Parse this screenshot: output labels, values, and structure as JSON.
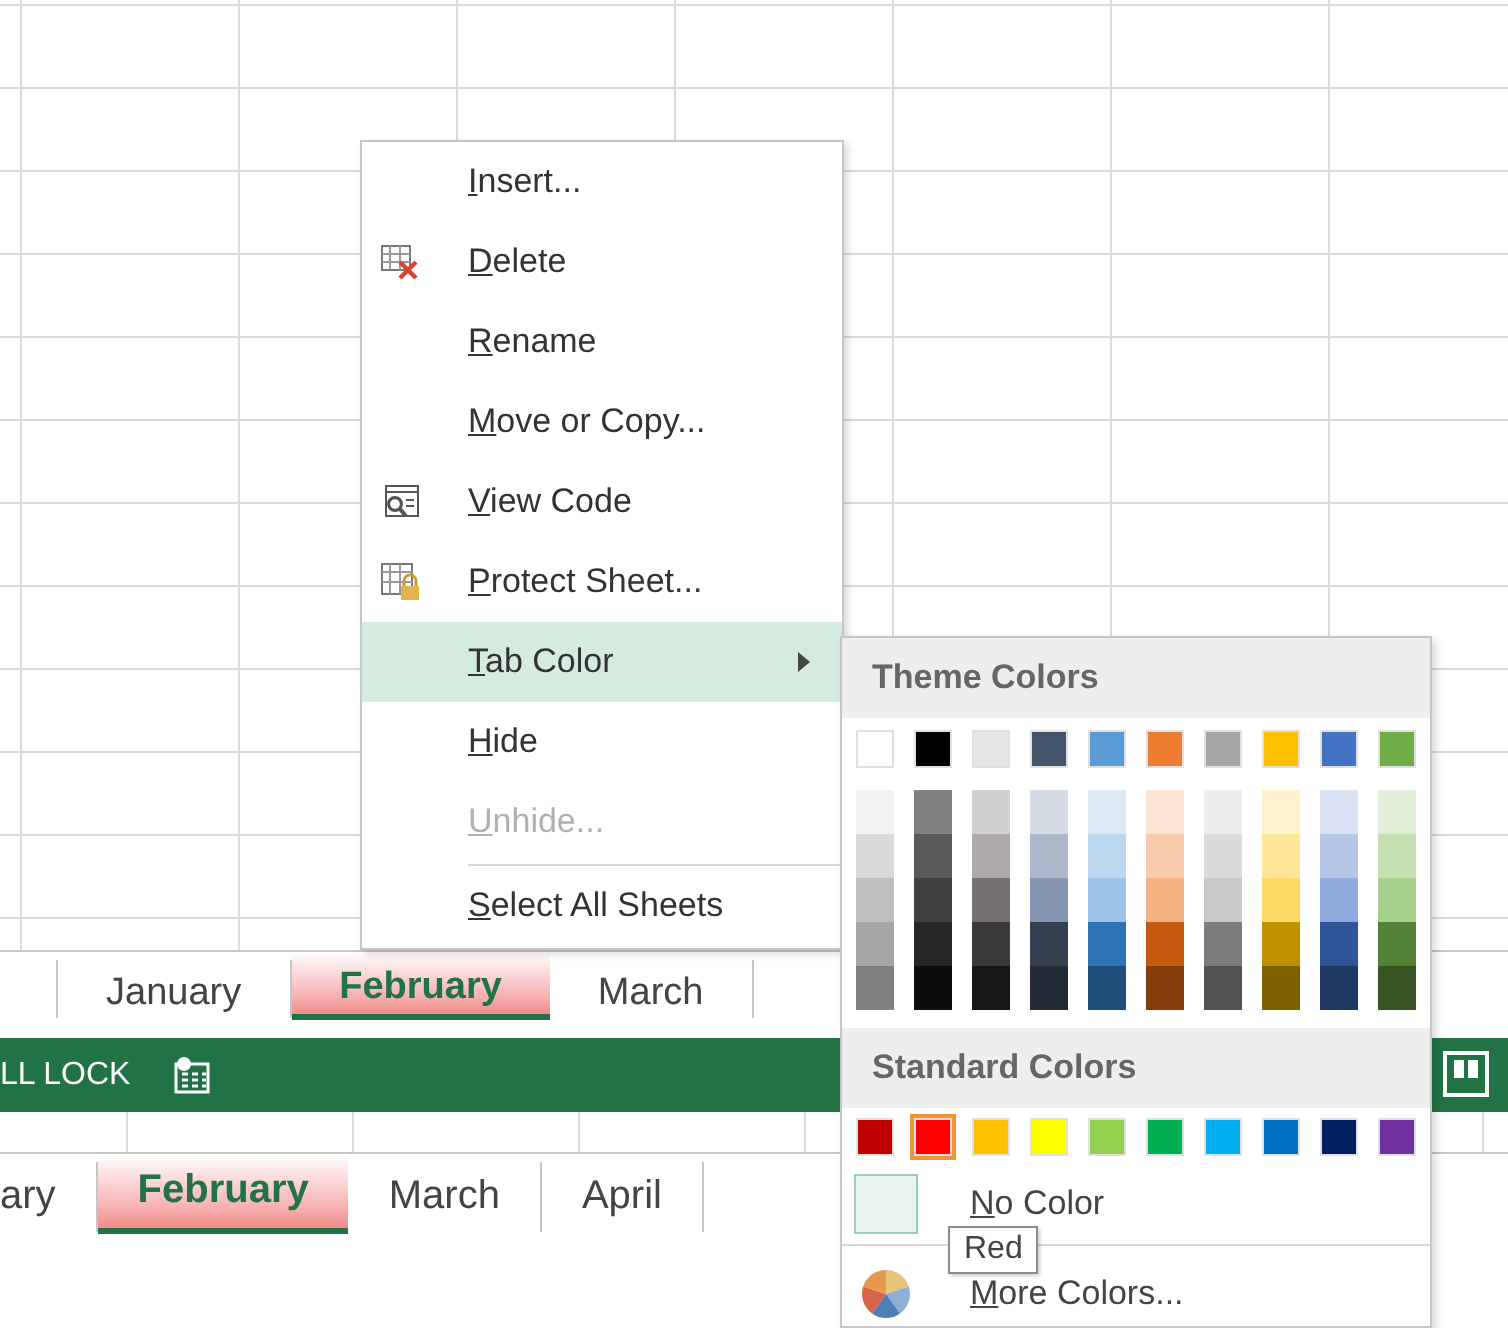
{
  "sheet_tabs_upper": [
    {
      "label": "January",
      "selected": false
    },
    {
      "label": "February",
      "selected": true
    },
    {
      "label": "March",
      "selected": false
    }
  ],
  "status_bar": {
    "text": "LL LOCK"
  },
  "sheet_tabs_lower": [
    {
      "label": "ary",
      "selected": false
    },
    {
      "label": "February",
      "selected": true
    },
    {
      "label": "March",
      "selected": false
    },
    {
      "label": "April",
      "selected": false
    }
  ],
  "context_menu": {
    "items": [
      {
        "label": "Insert...",
        "kind": "plain",
        "disabled": false,
        "selected": false
      },
      {
        "label": "Delete",
        "kind": "delete",
        "disabled": false,
        "selected": false
      },
      {
        "label": "Rename",
        "kind": "plain",
        "disabled": false,
        "selected": false
      },
      {
        "label": "Move or Copy...",
        "kind": "plain",
        "disabled": false,
        "selected": false
      },
      {
        "label": "View Code",
        "kind": "code",
        "disabled": false,
        "selected": false
      },
      {
        "label": "Protect Sheet...",
        "kind": "protect",
        "disabled": false,
        "selected": false
      },
      {
        "label": "Tab Color",
        "kind": "plain",
        "disabled": false,
        "selected": true,
        "submenu": true
      },
      {
        "label": "Hide",
        "kind": "plain",
        "disabled": false,
        "selected": false
      },
      {
        "label": "Unhide...",
        "kind": "plain",
        "disabled": true,
        "selected": false
      },
      {
        "label": "Select All Sheets",
        "kind": "plain",
        "disabled": false,
        "selected": false,
        "separator_before": true
      }
    ]
  },
  "tab_color_submenu": {
    "theme_header": "Theme Colors",
    "theme_colors": [
      {
        "color": "#ffffff",
        "shades": [
          {
            "color": "#f2f2f2"
          },
          {
            "color": "#d9d9d9"
          },
          {
            "color": "#bfbfbf"
          },
          {
            "color": "#a6a6a6"
          },
          {
            "color": "#808080"
          }
        ]
      },
      {
        "color": "#000000",
        "shades": [
          {
            "color": "#808080"
          },
          {
            "color": "#595959"
          },
          {
            "color": "#404040"
          },
          {
            "color": "#262626"
          },
          {
            "color": "#0d0d0d"
          }
        ]
      },
      {
        "color": "#e7e6e6",
        "shades": [
          {
            "color": "#d0cece"
          },
          {
            "color": "#aeaaaa"
          },
          {
            "color": "#757171"
          },
          {
            "color": "#3a3838"
          },
          {
            "color": "#181717"
          }
        ]
      },
      {
        "color": "#44546a",
        "shades": [
          {
            "color": "#d6dce4"
          },
          {
            "color": "#adb9ca"
          },
          {
            "color": "#8496b0"
          },
          {
            "color": "#333f4f"
          },
          {
            "color": "#222a35"
          }
        ]
      },
      {
        "color": "#5b9bd5",
        "shades": [
          {
            "color": "#deebf6"
          },
          {
            "color": "#bdd7ee"
          },
          {
            "color": "#9dc3e6"
          },
          {
            "color": "#2e75b5"
          },
          {
            "color": "#1f4e79"
          }
        ]
      },
      {
        "color": "#ed7d31",
        "shades": [
          {
            "color": "#fbe5d5"
          },
          {
            "color": "#f8cbad"
          },
          {
            "color": "#f4b183"
          },
          {
            "color": "#c55a11"
          },
          {
            "color": "#843c0b"
          }
        ]
      },
      {
        "color": "#a5a5a5",
        "shades": [
          {
            "color": "#ededed"
          },
          {
            "color": "#dbdbdb"
          },
          {
            "color": "#c9c9c9"
          },
          {
            "color": "#7b7b7b"
          },
          {
            "color": "#525252"
          }
        ]
      },
      {
        "color": "#ffc000",
        "shades": [
          {
            "color": "#fff2cc"
          },
          {
            "color": "#fee599"
          },
          {
            "color": "#ffd965"
          },
          {
            "color": "#bf9000"
          },
          {
            "color": "#7f6000"
          }
        ]
      },
      {
        "color": "#4472c4",
        "shades": [
          {
            "color": "#dae3f3"
          },
          {
            "color": "#b4c7e7"
          },
          {
            "color": "#8faadc"
          },
          {
            "color": "#2f5597"
          },
          {
            "color": "#203864"
          }
        ]
      },
      {
        "color": "#70ad47",
        "shades": [
          {
            "color": "#e2efd9"
          },
          {
            "color": "#c5e0b3"
          },
          {
            "color": "#a8d08d"
          },
          {
            "color": "#538135"
          },
          {
            "color": "#375623"
          }
        ]
      }
    ],
    "standard_header": "Standard Colors",
    "standard_colors": [
      {
        "color": "#c00000",
        "selected": false
      },
      {
        "color": "#ff0000",
        "selected": true
      },
      {
        "color": "#ffc000",
        "selected": false
      },
      {
        "color": "#ffff00",
        "selected": false
      },
      {
        "color": "#92d050",
        "selected": false
      },
      {
        "color": "#00b050",
        "selected": false
      },
      {
        "color": "#00b0f0",
        "selected": false
      },
      {
        "color": "#0070c0",
        "selected": false
      },
      {
        "color": "#002060",
        "selected": false
      },
      {
        "color": "#7030a0",
        "selected": false
      }
    ],
    "no_color": {
      "label": "No Color"
    },
    "more_colors": {
      "label": "More Colors..."
    }
  },
  "tooltip": {
    "text": "Red"
  }
}
